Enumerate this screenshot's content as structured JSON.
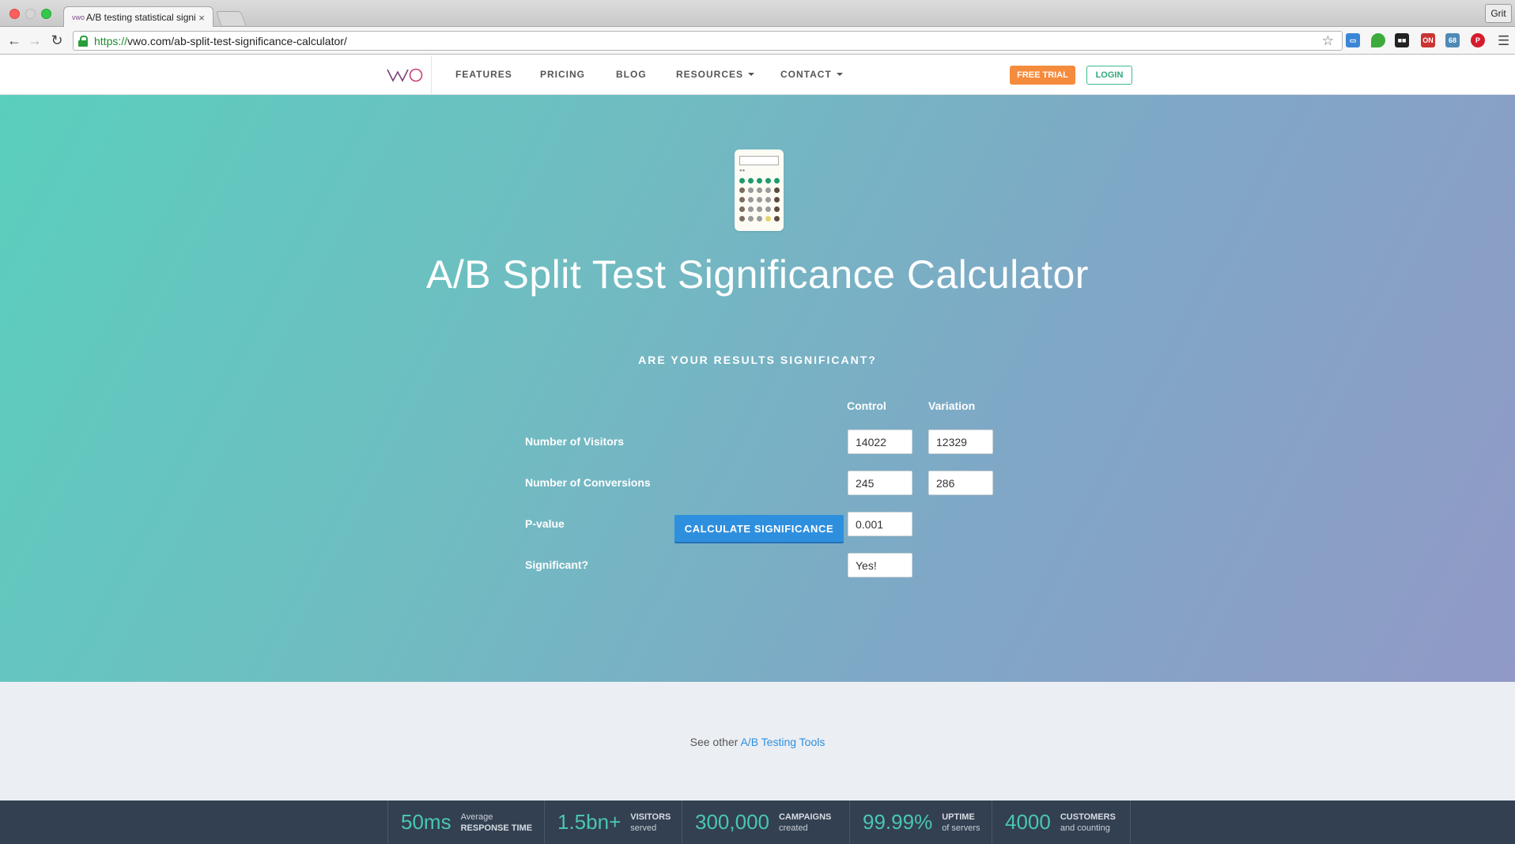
{
  "browser": {
    "tab_title": "A/B testing statistical signi",
    "tab_favicon": "vwo",
    "tab_close": "×",
    "url_scheme": "https://",
    "url_rest": "vwo.com/ab-split-test-significance-calculator/",
    "profile_label": "Grit"
  },
  "header": {
    "nav": [
      {
        "label": "FEATURES"
      },
      {
        "label": "PRICING"
      },
      {
        "label": "BLOG"
      },
      {
        "label": "RESOURCES"
      },
      {
        "label": "CONTACT"
      }
    ],
    "free_trial": "FREE TRIAL",
    "login": "LOGIN",
    "brand_color": "#f58b3c",
    "login_color": "#30a87a"
  },
  "hero": {
    "title": "A/B Split Test Significance Calculator",
    "subtitle": "ARE YOUR RESULTS SIGNIFICANT?",
    "col_control": "Control",
    "col_variation": "Variation",
    "rows": {
      "visitors": {
        "label": "Number of Visitors",
        "control": "14022",
        "variation": "12329"
      },
      "conversions": {
        "label": "Number of Conversions",
        "control": "245",
        "variation": "286"
      },
      "pvalue": {
        "label": "P-value",
        "control": "0.001"
      },
      "significant": {
        "label": "Significant?",
        "control": "Yes!"
      }
    },
    "button": "CALCULATE SIGNIFICANCE",
    "button_color": "#2f8fdf"
  },
  "tools": {
    "prefix": "See other",
    "link": "A/B Testing Tools"
  },
  "stats": [
    {
      "value": "50ms",
      "top": "Average",
      "bottom": "RESPONSE TIME",
      "bold": "bottom"
    },
    {
      "value": "1.5bn+",
      "top": "VISITORS",
      "bottom": "served",
      "bold": "top"
    },
    {
      "value": "300,000",
      "top": "CAMPAIGNS",
      "bottom": "created",
      "bold": "top"
    },
    {
      "value": "99.99%",
      "top": "UPTIME",
      "bottom": "of servers",
      "bold": "top"
    },
    {
      "value": "4000",
      "top": "CUSTOMERS",
      "bottom": "and counting",
      "bold": "top"
    }
  ]
}
